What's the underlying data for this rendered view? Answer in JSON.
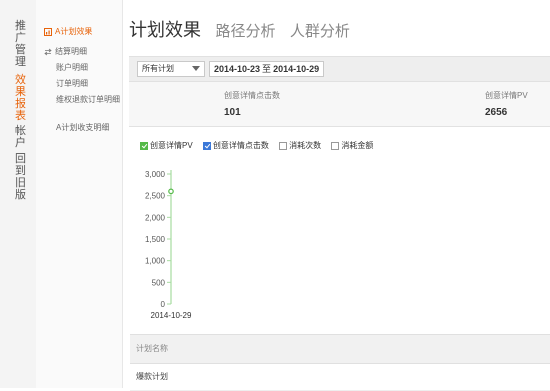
{
  "left_nav": [
    {
      "label": "推广管理"
    },
    {
      "label": "效果报表"
    },
    {
      "label": "帐户"
    },
    {
      "label": "回到旧版"
    }
  ],
  "submenu": {
    "active": "A计划效果",
    "settlement": "结算明细",
    "items": [
      "账户明细",
      "订单明细",
      "维权退款订单明细",
      "A计划收支明细"
    ]
  },
  "tabs": [
    "计划效果",
    "路径分析",
    "人群分析"
  ],
  "filter": {
    "plan_select": "所有计划",
    "date_from": "2014-10-23",
    "date_sep": "至",
    "date_to": "2014-10-29"
  },
  "stats": [
    {
      "label": "创意详情点击数",
      "value": "101"
    },
    {
      "label": "创意详情PV",
      "value": "2656"
    }
  ],
  "legend": [
    {
      "label": "创意详情PV",
      "checked": true,
      "color": "#54b948"
    },
    {
      "label": "创意详情点击数",
      "checked": true,
      "color": "#3b78d8"
    },
    {
      "label": "消耗次数",
      "checked": false
    },
    {
      "label": "消耗金额",
      "checked": false
    }
  ],
  "chart_data": {
    "type": "line",
    "x": [
      "2014-10-29"
    ],
    "series": [
      {
        "values": [
          2600
        ],
        "color": "#54b948"
      }
    ],
    "yticks": [
      "3,000",
      "2,500",
      "2,000",
      "1,500",
      "1,000",
      "500",
      "0"
    ],
    "ylim": [
      0,
      3000
    ],
    "xticks": [
      "2014-10-29"
    ]
  },
  "table": {
    "header": "计划名称",
    "rows": [
      "爆款计划"
    ]
  },
  "colors": {
    "accent": "#e8630a",
    "series_pv": "#54b948",
    "series_clicks": "#3b78d8"
  }
}
